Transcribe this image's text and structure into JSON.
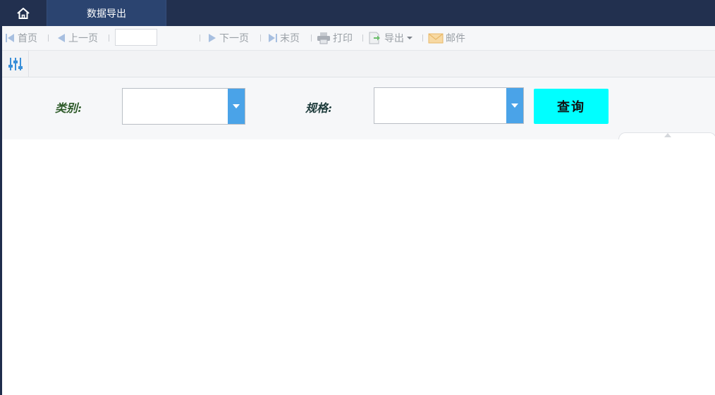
{
  "topbar": {
    "home_icon": "home-icon",
    "active_tab": "数据导出"
  },
  "toolbar": {
    "first_page": "首页",
    "prev_page": "上一页",
    "page_input_value": "",
    "next_page": "下一页",
    "last_page": "末页",
    "print": "打印",
    "export": "导出",
    "mail": "邮件",
    "icon_color": "#a7bfe0"
  },
  "params": {
    "toggle_icon": "sliders-icon",
    "category_label": "类别:",
    "category_value": "",
    "spec_label": "规格:",
    "spec_value": "",
    "query_button": "查询",
    "colors": {
      "category_label": "#2e5b2a",
      "spec_label": "#1d3b3b",
      "dropdown_arrow_bg": "#4aa3e8",
      "query_button_bg": "#00ffff"
    }
  }
}
